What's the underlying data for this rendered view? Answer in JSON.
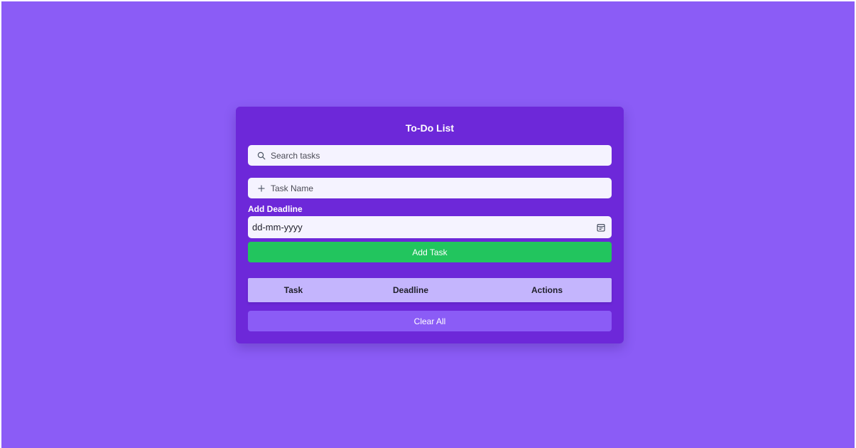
{
  "app": {
    "title": "To-Do List"
  },
  "search": {
    "placeholder": "Search tasks",
    "icon": "search-icon"
  },
  "task_input": {
    "placeholder": "Task Name",
    "icon": "plus-icon"
  },
  "deadline": {
    "label": "Add Deadline",
    "value": "dd-mm-yyyy",
    "icon": "calendar-icon"
  },
  "buttons": {
    "add_task": "Add Task",
    "clear_all": "Clear All"
  },
  "table": {
    "columns": [
      "Task",
      "Deadline",
      "Actions"
    ]
  },
  "colors": {
    "page_background": "#8b5cf6",
    "card_background": "#6d28d9",
    "input_background": "#f5f3ff",
    "add_button": "#22c55e",
    "table_header": "#c4b5fd",
    "clear_button": "#8b5cf6"
  }
}
